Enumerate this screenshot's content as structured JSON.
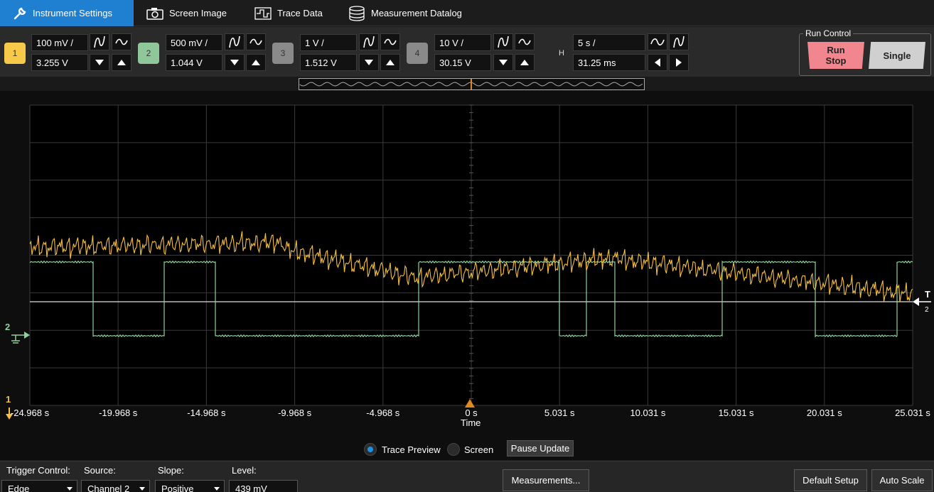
{
  "tabs": [
    {
      "label": "Instrument Settings",
      "icon": "wrench-icon",
      "active": true
    },
    {
      "label": "Screen Image",
      "icon": "camera-icon",
      "active": false
    },
    {
      "label": "Trace Data",
      "icon": "waveform-icon",
      "active": false
    },
    {
      "label": "Measurement Datalog",
      "icon": "database-icon",
      "active": false
    }
  ],
  "channels": [
    {
      "number": "1",
      "scale": "100 mV /",
      "offset": "3.255 V",
      "color": "#f7c948"
    },
    {
      "number": "2",
      "scale": "500 mV /",
      "offset": "1.044 V",
      "color": "#8fc79a"
    },
    {
      "number": "3",
      "scale": "1 V /",
      "offset": "1.512 V",
      "color": "#8a8a8a"
    },
    {
      "number": "4",
      "scale": "10 V /",
      "offset": "30.15 V",
      "color": "#8a8a8a"
    }
  ],
  "horizontal": {
    "label": "H",
    "scale": "5 s /",
    "delay": "31.25 ms"
  },
  "run_control": {
    "title": "Run Control",
    "run_stop": "Run\nStop",
    "run_label": "Run",
    "stop_label": "Stop",
    "single": "Single"
  },
  "scope": {
    "x_ticks": [
      "-24.968 s",
      "-19.968 s",
      "-14.968 s",
      "-9.968 s",
      "-4.968 s",
      "0 s",
      "5.031 s",
      "10.031 s",
      "15.031 s",
      "20.031 s",
      "25.031 s"
    ],
    "x_axis_label": "Time",
    "ch2_marker": "2",
    "ch1_marker": "1",
    "trigger_marker": "T",
    "trigger_marker_sub": "2",
    "ch1_color": "#f5c043",
    "ch2_color": "#8fd19e"
  },
  "preview": {
    "trace_preview": "Trace Preview",
    "screen": "Screen",
    "pause": "Pause Update",
    "selected": "Trace Preview"
  },
  "trigger": {
    "control_label": "Trigger Control:",
    "control_value": "Edge",
    "source_label": "Source:",
    "source_value": "Channel 2",
    "slope_label": "Slope:",
    "slope_value": "Positive",
    "level_label": "Level:",
    "level_value": "439 mV"
  },
  "buttons": {
    "measurements": "Measurements...",
    "default_setup": "Default Setup",
    "auto_scale": "Auto Scale"
  }
}
